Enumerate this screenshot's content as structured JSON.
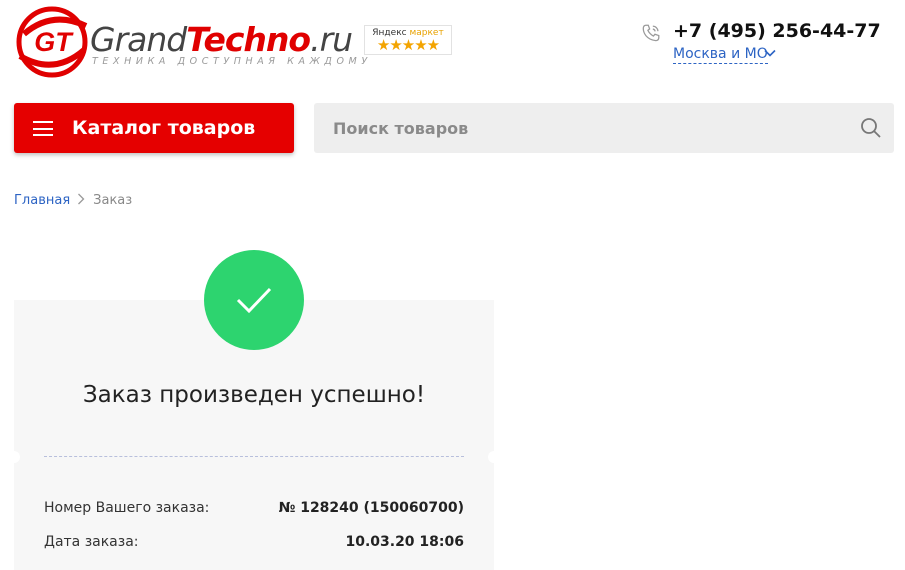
{
  "header": {
    "logo": {
      "mark": "GT",
      "brand_part1": "Grand",
      "brand_part2": "Techno",
      "brand_part3": ".ru",
      "tagline": "ТЕХНИКА ДОСТУПНАЯ КАЖДОМУ"
    },
    "yandex_market": {
      "label_part1": "Яндекс",
      "label_part2": "маркет",
      "rating_stars": 5
    },
    "phone": "+7 (495) 256-44-77",
    "city": "Москва и МО"
  },
  "nav": {
    "catalog_label": "Каталог товаров",
    "search_placeholder": "Поиск товаров"
  },
  "breadcrumb": {
    "home": "Главная",
    "current": "Заказ"
  },
  "order": {
    "title": "Заказ произведен успешно!",
    "fields": [
      {
        "label": "Номер Вашего заказа:",
        "value": "№ 128240 (150060700)"
      },
      {
        "label": "Дата заказа:",
        "value": "10.03.20 18:06"
      }
    ]
  },
  "colors": {
    "brand_red": "#e50000",
    "link_blue": "#2d64c4",
    "success_green": "#2dd46f",
    "star_orange": "#f3a400"
  }
}
